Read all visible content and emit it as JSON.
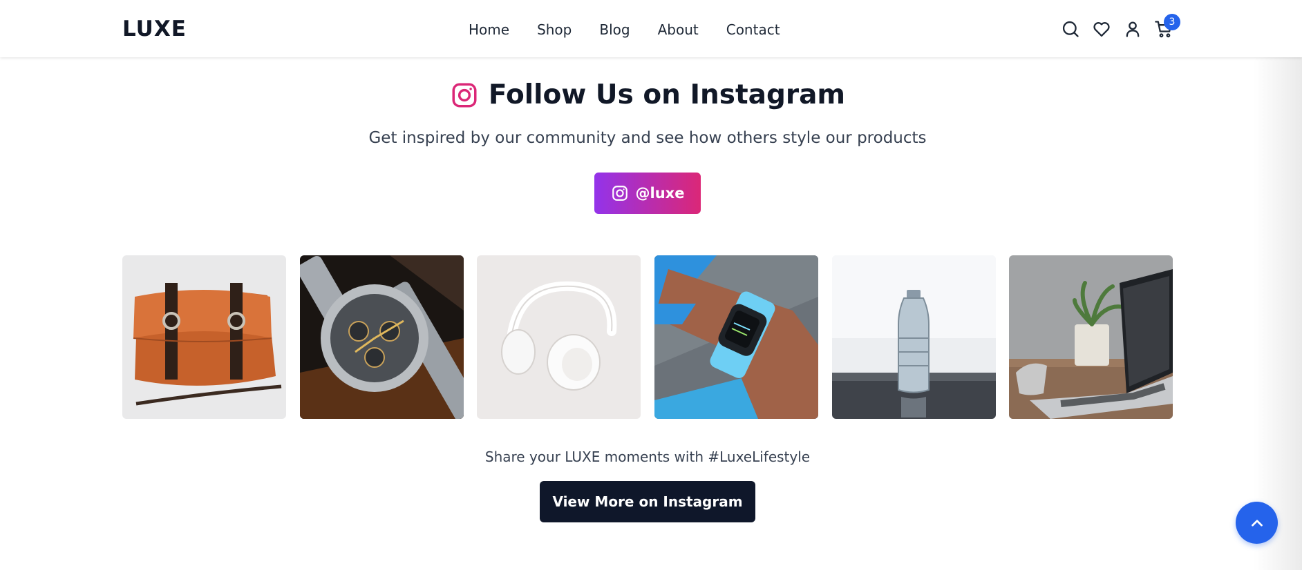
{
  "header": {
    "logo": "LUXE",
    "nav": [
      "Home",
      "Shop",
      "Blog",
      "About",
      "Contact"
    ],
    "icons": [
      "search-icon",
      "heart-icon",
      "user-icon",
      "cart-icon"
    ],
    "cart_count": "3"
  },
  "instagram": {
    "title": "Follow Us on Instagram",
    "subtitle": "Get inspired by our community and see how others style our products",
    "handle": "@luxe",
    "hashtag_text": "Share your LUXE moments with #LuxeLifestyle",
    "cta": "View More on Instagram",
    "posts": [
      {
        "subject": "leather messenger bag"
      },
      {
        "subject": "chronograph wristwatch"
      },
      {
        "subject": "white headphones"
      },
      {
        "subject": "smartwatch on wrist"
      },
      {
        "subject": "water bottle"
      },
      {
        "subject": "laptop with plant"
      }
    ]
  },
  "colors": {
    "accent_blue": "#2563eb",
    "instagram_gradient_start": "#9333ea",
    "instagram_gradient_end": "#db2777",
    "dark_button": "#0f172a"
  }
}
